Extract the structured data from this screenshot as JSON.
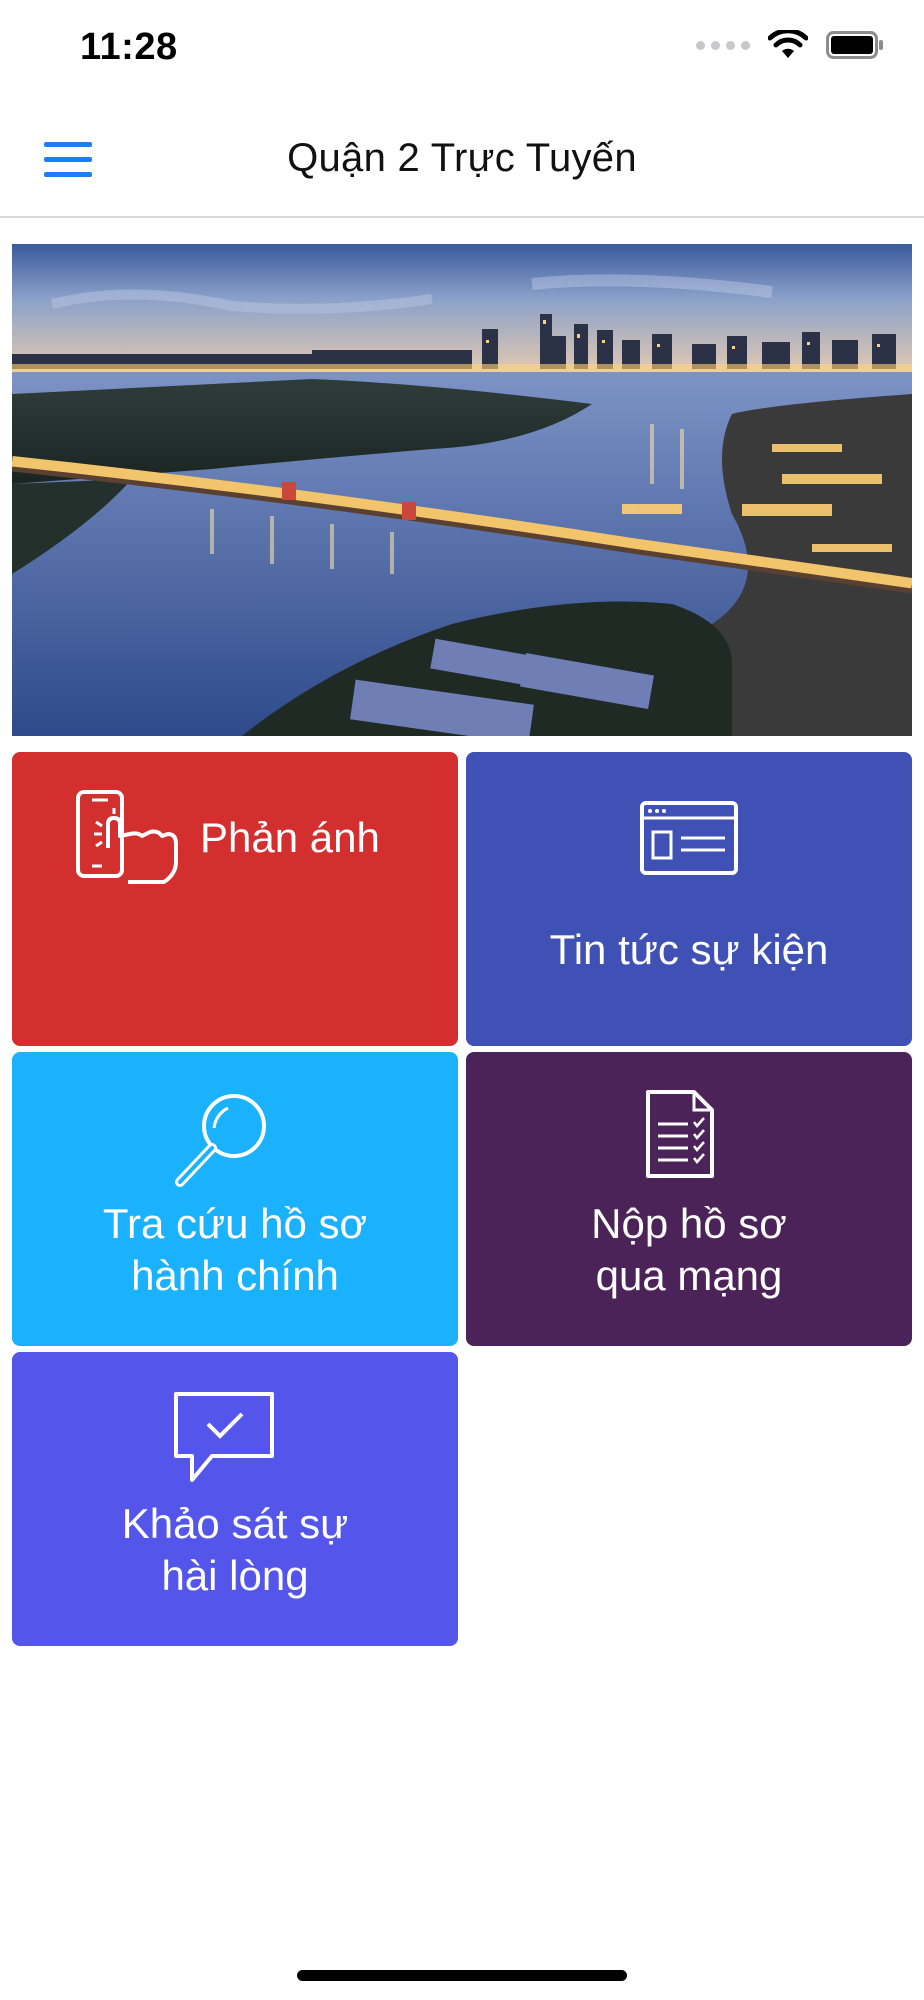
{
  "status_bar": {
    "time": "11:28",
    "signal_icon": "cellular-signal-icon",
    "wifi_icon": "wifi-icon",
    "battery_icon": "battery-icon"
  },
  "nav": {
    "title": "Quận 2 Trực Tuyến",
    "menu_icon": "hamburger-menu-icon"
  },
  "banner": {
    "icon": "city-night-river-photo"
  },
  "tiles": [
    {
      "label": "Phản ánh",
      "icon": "touch-phone-icon",
      "color": "#d32f2f"
    },
    {
      "label": "Tin tức sự kiện",
      "icon": "browser-window-icon",
      "color": "#4051b5"
    },
    {
      "label_line1": "Tra cứu hồ sơ",
      "label_line2": "hành chính",
      "icon": "magnifier-icon",
      "color": "#1ab2fc"
    },
    {
      "label_line1": "Nộp hồ sơ",
      "label_line2": "qua mạng",
      "icon": "document-checklist-icon",
      "color": "#4b2358"
    },
    {
      "label_line1": "Khảo sát sự",
      "label_line2": "hài lòng",
      "icon": "chat-check-icon",
      "color": "#5455ea"
    }
  ]
}
